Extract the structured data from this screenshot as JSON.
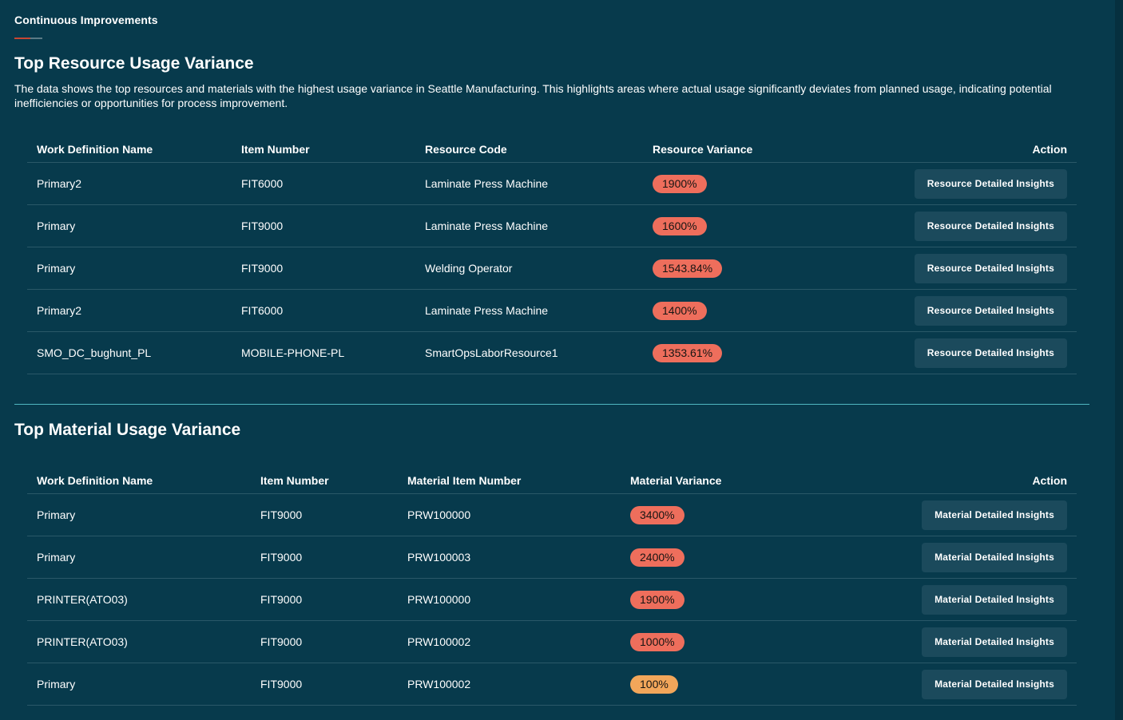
{
  "app_title": "Continuous Improvements",
  "colors": {
    "background": "#073a4c",
    "badge_high": "#ee6e5c",
    "badge_low": "#f2a65a",
    "button_bg": "#1b4a5c",
    "divider": "#4fb6c0"
  },
  "resource": {
    "title": "Top Resource Usage Variance",
    "description": "The data shows the top resources and materials with the highest usage variance in Seattle Manufacturing. This highlights areas where actual usage significantly deviates from planned usage, indicating potential inefficiencies or opportunities for process improvement.",
    "headers": {
      "work_def": "Work Definition Name",
      "item": "Item Number",
      "code": "Resource Code",
      "variance": "Resource Variance",
      "action": "Action"
    },
    "rows": [
      {
        "work_def": "Primary2",
        "item": "FIT6000",
        "code": "Laminate Press Machine",
        "variance": "1900%",
        "level": "high",
        "action": "Resource Detailed Insights"
      },
      {
        "work_def": "Primary",
        "item": "FIT9000",
        "code": "Laminate Press Machine",
        "variance": "1600%",
        "level": "high",
        "action": "Resource Detailed Insights"
      },
      {
        "work_def": "Primary",
        "item": "FIT9000",
        "code": "Welding Operator",
        "variance": "1543.84%",
        "level": "high",
        "action": "Resource Detailed Insights"
      },
      {
        "work_def": "Primary2",
        "item": "FIT6000",
        "code": "Laminate Press Machine",
        "variance": "1400%",
        "level": "high",
        "action": "Resource Detailed Insights"
      },
      {
        "work_def": "SMO_DC_bughunt_PL",
        "item": "MOBILE-PHONE-PL",
        "code": "SmartOpsLaborResource1",
        "variance": "1353.61%",
        "level": "high",
        "action": "Resource Detailed Insights"
      }
    ]
  },
  "material": {
    "title": "Top Material Usage Variance",
    "headers": {
      "work_def": "Work Definition Name",
      "item": "Item Number",
      "code": "Material Item Number",
      "variance": "Material Variance",
      "action": "Action"
    },
    "rows": [
      {
        "work_def": "Primary",
        "item": "FIT9000",
        "code": "PRW100000",
        "variance": "3400%",
        "level": "high",
        "action": "Material Detailed Insights"
      },
      {
        "work_def": "Primary",
        "item": "FIT9000",
        "code": "PRW100003",
        "variance": "2400%",
        "level": "high",
        "action": "Material Detailed Insights"
      },
      {
        "work_def": "PRINTER(ATO03)",
        "item": "FIT9000",
        "code": "PRW100000",
        "variance": "1900%",
        "level": "high",
        "action": "Material Detailed Insights"
      },
      {
        "work_def": "PRINTER(ATO03)",
        "item": "FIT9000",
        "code": "PRW100002",
        "variance": "1000%",
        "level": "high",
        "action": "Material Detailed Insights"
      },
      {
        "work_def": "Primary",
        "item": "FIT9000",
        "code": "PRW100002",
        "variance": "100%",
        "level": "low",
        "action": "Material Detailed Insights"
      }
    ]
  }
}
